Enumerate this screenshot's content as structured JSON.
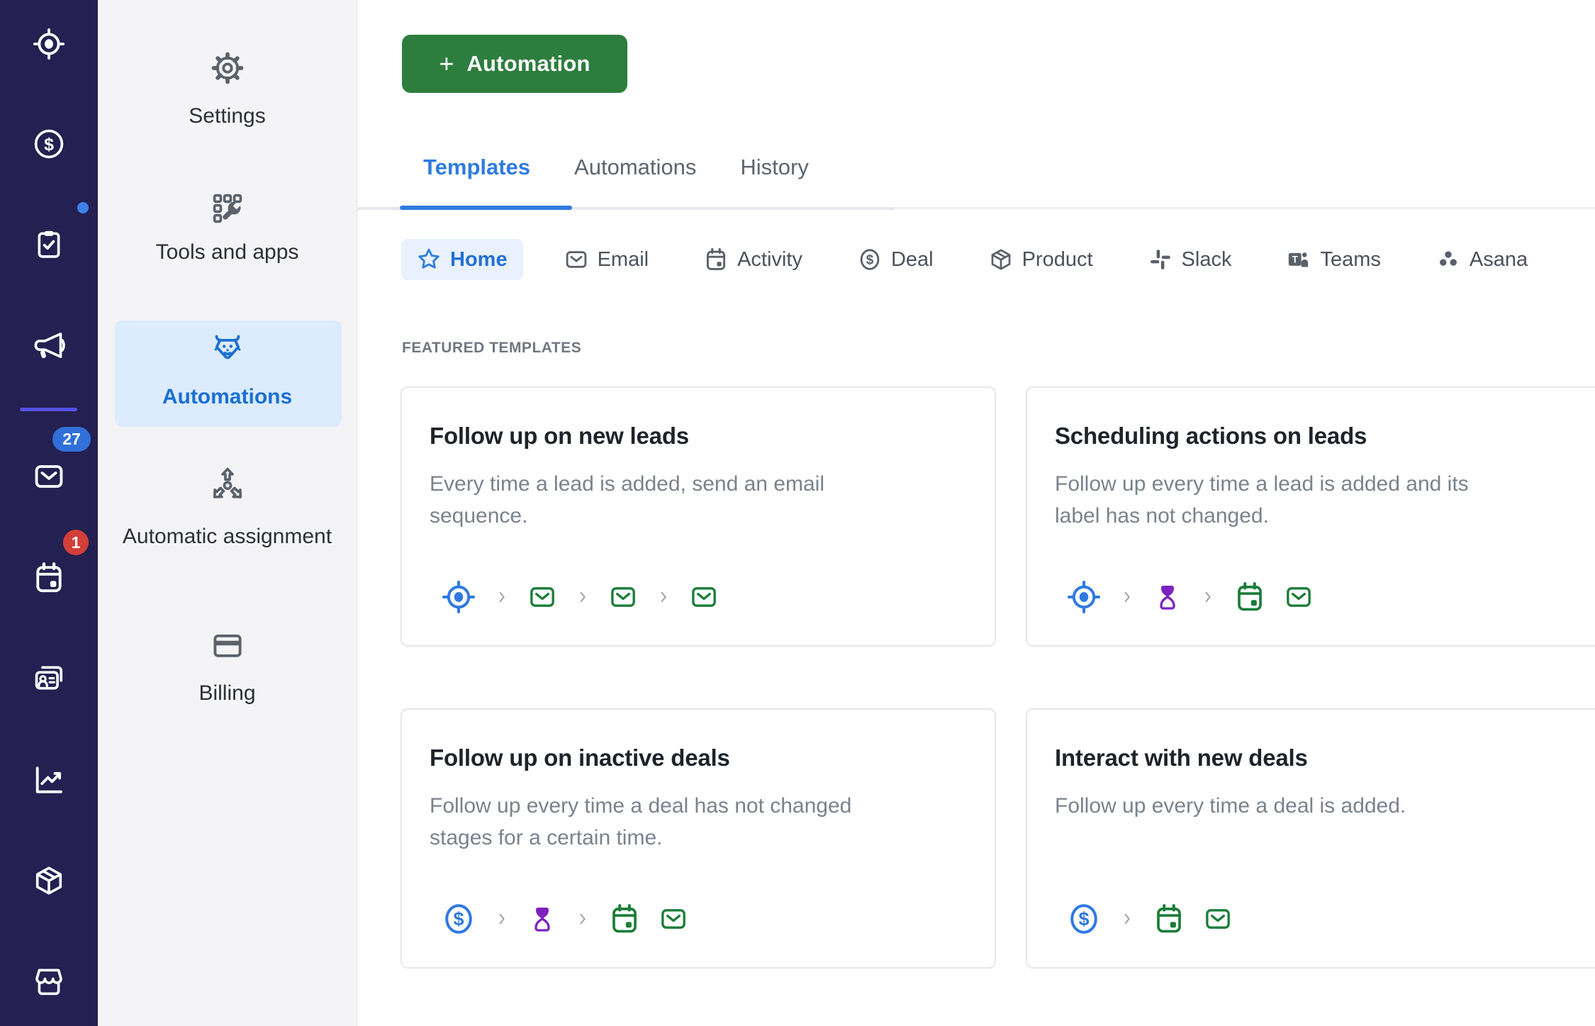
{
  "colors": {
    "nav_bg": "#242051",
    "nav_divider": "#5551e8",
    "badge_blue": "#3070d8",
    "badge_red": "#d23f39",
    "notification_dot": "#3e82e8",
    "sidebar_bg": "#f4f4f6",
    "sidebar_active_bg": "#dcebfd",
    "accent_blue": "#2e7be0",
    "button_green": "#2d7e3e",
    "flow_green": "#1a7d38",
    "flow_purple": "#7e22bf",
    "flow_blue": "#2f79e3"
  },
  "nav_rail": {
    "items": [
      {
        "icon": "leads-target-icon"
      },
      {
        "icon": "deals-dollar-icon"
      },
      {
        "icon": "tasks-clipboard-icon",
        "notification_dot": true
      },
      {
        "icon": "campaigns-megaphone-icon",
        "active": true
      },
      {
        "icon": "mail-icon",
        "badge": "27"
      },
      {
        "icon": "activities-calendar-icon",
        "badge": "1"
      },
      {
        "icon": "contacts-icon"
      },
      {
        "icon": "insights-icon"
      },
      {
        "icon": "products-icon"
      },
      {
        "icon": "marketplace-icon"
      }
    ]
  },
  "sidebar": {
    "items": [
      {
        "label": "Settings",
        "icon": "gear-icon"
      },
      {
        "label": "Tools and apps",
        "icon": "tools-wrench-icon"
      },
      {
        "label": "Automations",
        "icon": "robot-icon",
        "active": true
      },
      {
        "label": "Automatic assignment",
        "icon": "branch-arrows-icon"
      },
      {
        "label": "Billing",
        "icon": "credit-card-icon"
      }
    ]
  },
  "toolbar": {
    "plus": "+",
    "add_automation_label": "Automation"
  },
  "tabs": {
    "items": [
      {
        "label": "Templates",
        "active": true
      },
      {
        "label": "Automations"
      },
      {
        "label": "History"
      }
    ]
  },
  "filters": {
    "items": [
      {
        "label": "Home",
        "icon": "star-icon",
        "active": true
      },
      {
        "label": "Email",
        "icon": "envelope-icon"
      },
      {
        "label": "Activity",
        "icon": "calendar-icon"
      },
      {
        "label": "Deal",
        "icon": "dollar-circle-icon"
      },
      {
        "label": "Product",
        "icon": "box-icon"
      },
      {
        "label": "Slack",
        "icon": "slack-icon"
      },
      {
        "label": "Teams",
        "icon": "teams-icon"
      },
      {
        "label": "Asana",
        "icon": "asana-icon"
      }
    ]
  },
  "templates": {
    "section_heading": "FEATURED TEMPLATES",
    "cards": [
      {
        "title": "Follow up on new leads",
        "description": "Every time a lead is added, send an email sequence.",
        "flow": [
          "lead-target",
          "chevron",
          "email",
          "chevron",
          "email",
          "chevron",
          "email"
        ]
      },
      {
        "title": "Scheduling actions on leads",
        "description": "Follow up every time a lead is added and its label has not changed.",
        "flow": [
          "lead-target",
          "chevron",
          "wait-hourglass",
          "chevron",
          "activity-calendar",
          "email"
        ]
      },
      {
        "title": "Follow up on inactive deals",
        "description": "Follow up every time a deal has not changed stages for a certain time.",
        "flow": [
          "deal-dollar",
          "chevron",
          "wait-hourglass",
          "chevron",
          "activity-calendar",
          "email"
        ]
      },
      {
        "title": "Interact with new deals",
        "description": "Follow up every time a deal is added.",
        "flow": [
          "deal-dollar",
          "chevron",
          "activity-calendar",
          "email"
        ]
      }
    ]
  }
}
